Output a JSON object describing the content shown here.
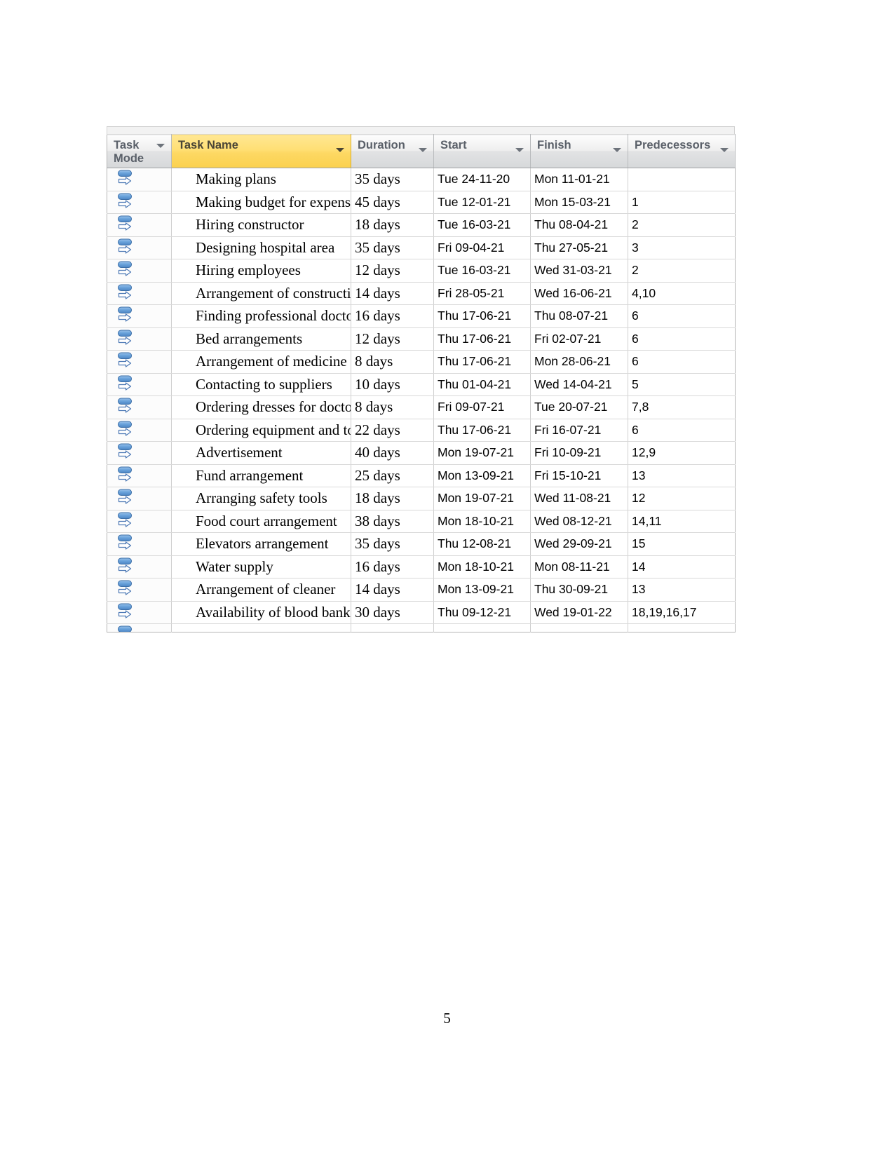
{
  "document": {
    "page_number": "5"
  },
  "grid": {
    "columns": [
      {
        "key": "task_mode",
        "label": "Task\nMode",
        "name": "task-mode"
      },
      {
        "key": "task_name",
        "label": "Task Name",
        "name": "task-name",
        "selected": true
      },
      {
        "key": "duration",
        "label": "Duration",
        "name": "duration"
      },
      {
        "key": "start",
        "label": "Start",
        "name": "start"
      },
      {
        "key": "finish",
        "label": "Finish",
        "name": "finish"
      },
      {
        "key": "predecessors",
        "label": "Predecessors",
        "name": "predecessors"
      }
    ],
    "header_accent_color": "#fbd14f",
    "mode_icon": "auto-scheduled-icon",
    "rows": [
      {
        "id": 1,
        "task_name": "Making plans",
        "duration": "35 days",
        "start": "Tue 24-11-20",
        "finish": "Mon 11-01-21",
        "predecessors": ""
      },
      {
        "id": 2,
        "task_name": "Making budget for expenses",
        "duration": "45 days",
        "start": "Tue 12-01-21",
        "finish": "Mon 15-03-21",
        "predecessors": "1"
      },
      {
        "id": 3,
        "task_name": "Hiring constructor",
        "duration": "18 days",
        "start": "Tue 16-03-21",
        "finish": "Thu 08-04-21",
        "predecessors": "2"
      },
      {
        "id": 4,
        "task_name": "Designing hospital area",
        "duration": "35 days",
        "start": "Fri 09-04-21",
        "finish": "Thu 27-05-21",
        "predecessors": "3"
      },
      {
        "id": 5,
        "task_name": "Hiring employees",
        "duration": "12 days",
        "start": "Tue 16-03-21",
        "finish": "Wed 31-03-21",
        "predecessors": "2"
      },
      {
        "id": 6,
        "task_name": "Arrangement of construction",
        "duration": "14 days",
        "start": "Fri 28-05-21",
        "finish": "Wed 16-06-21",
        "predecessors": "4,10"
      },
      {
        "id": 7,
        "task_name": "Finding professional doctors",
        "duration": "16 days",
        "start": "Thu 17-06-21",
        "finish": "Thu 08-07-21",
        "predecessors": "6"
      },
      {
        "id": 8,
        "task_name": "Bed arrangements",
        "duration": "12 days",
        "start": "Thu 17-06-21",
        "finish": "Fri 02-07-21",
        "predecessors": "6"
      },
      {
        "id": 9,
        "task_name": "Arrangement of medicine",
        "duration": "8 days",
        "start": "Thu 17-06-21",
        "finish": "Mon 28-06-21",
        "predecessors": "6"
      },
      {
        "id": 10,
        "task_name": "Contacting to suppliers",
        "duration": "10 days",
        "start": "Thu 01-04-21",
        "finish": "Wed 14-04-21",
        "predecessors": "5"
      },
      {
        "id": 11,
        "task_name": "Ordering dresses for doctors",
        "duration": "8 days",
        "start": "Fri 09-07-21",
        "finish": "Tue 20-07-21",
        "predecessors": "7,8"
      },
      {
        "id": 12,
        "task_name": "Ordering equipment and tools",
        "duration": "22 days",
        "start": "Thu 17-06-21",
        "finish": "Fri 16-07-21",
        "predecessors": "6"
      },
      {
        "id": 13,
        "task_name": "Advertisement",
        "duration": "40 days",
        "start": "Mon 19-07-21",
        "finish": "Fri 10-09-21",
        "predecessors": "12,9"
      },
      {
        "id": 14,
        "task_name": "Fund arrangement",
        "duration": "25 days",
        "start": "Mon 13-09-21",
        "finish": "Fri 15-10-21",
        "predecessors": "13"
      },
      {
        "id": 15,
        "task_name": "Arranging safety tools",
        "duration": "18 days",
        "start": "Mon 19-07-21",
        "finish": "Wed 11-08-21",
        "predecessors": "12"
      },
      {
        "id": 16,
        "task_name": "Food court arrangement",
        "duration": "38 days",
        "start": "Mon 18-10-21",
        "finish": "Wed 08-12-21",
        "predecessors": "14,11"
      },
      {
        "id": 17,
        "task_name": "Elevators arrangement",
        "duration": "35 days",
        "start": "Thu 12-08-21",
        "finish": "Wed 29-09-21",
        "predecessors": "15"
      },
      {
        "id": 18,
        "task_name": "Water supply",
        "duration": "16 days",
        "start": "Mon 18-10-21",
        "finish": "Mon 08-11-21",
        "predecessors": "14"
      },
      {
        "id": 19,
        "task_name": "Arrangement of cleaner",
        "duration": "14 days",
        "start": "Mon 13-09-21",
        "finish": "Thu 30-09-21",
        "predecessors": "13"
      },
      {
        "id": 20,
        "task_name": "Availability of blood bank",
        "duration": "30 days",
        "start": "Thu 09-12-21",
        "finish": "Wed 19-01-22",
        "predecessors": "18,19,16,17"
      }
    ]
  }
}
